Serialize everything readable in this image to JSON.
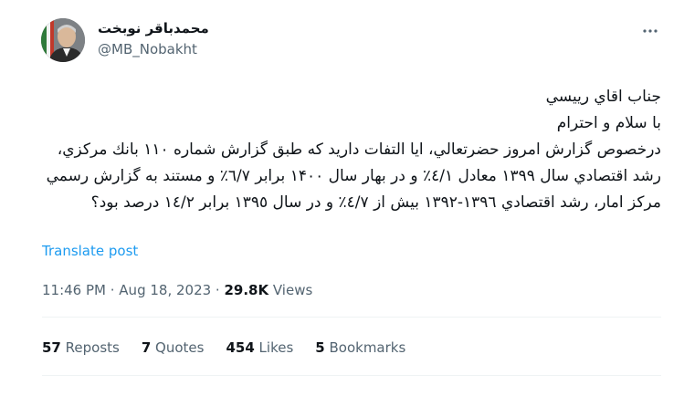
{
  "author": {
    "name": "محمدباقر نوبخت",
    "handle": "@MB_Nobakht"
  },
  "post": {
    "text": "جناب اقاي رييسي\nبا سلام و احترام\nدرخصوص گزارش امروز حضرتعالي، ايا التفات داريد كه طبق گزارش شماره ١١٠ بانك مركزي، رشد اقتصادي سال ١٣٩٩ معادل ٤/١٪ و در بهار سال ١۴٠٠ برابر ٦/٧٪ و مستند به گزارش رسمي مركز امار، رشد اقتصادي ١٣٩٦-١٣٩٢ بيش از ٤/٧٪ و در سال ١٣٩٥ برابر ١٤/٢ درصد بود؟",
    "translate_label": "Translate post"
  },
  "meta": {
    "time": "11:46 PM",
    "date": "Aug 18, 2023",
    "sep1": " · ",
    "sep2": " · ",
    "views_count": "29.8K",
    "views_label": " Views"
  },
  "stats": {
    "reposts_count": "57",
    "reposts_label": " Reposts",
    "quotes_count": "7",
    "quotes_label": " Quotes",
    "likes_count": "454",
    "likes_label": " Likes",
    "bookmarks_count": "5",
    "bookmarks_label": " Bookmarks"
  },
  "icons": {
    "more": "more-horizontal-icon"
  }
}
